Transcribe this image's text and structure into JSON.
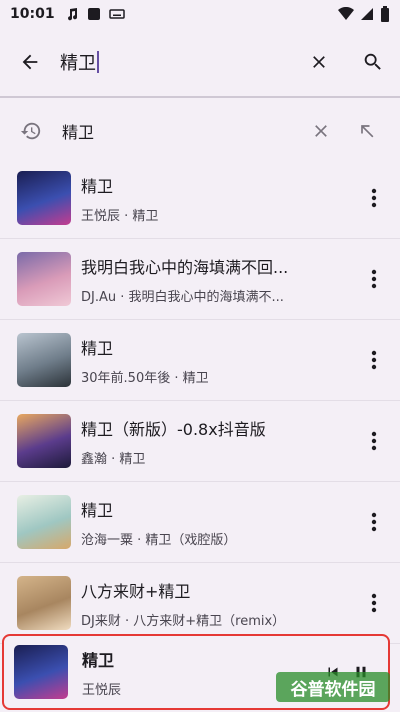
{
  "status_bar": {
    "time": "10:01"
  },
  "search": {
    "query": "精卫"
  },
  "history": {
    "text": "精卫"
  },
  "results": [
    {
      "title": "精卫",
      "subtitle": "王悦辰 · 精卫",
      "art_colors": [
        "#1a1e52",
        "#3b4fb0",
        "#c43c8f"
      ]
    },
    {
      "title": "我明白我心中的海填满不回...",
      "subtitle": "DJ.Au · 我明白我心中的海填满不...",
      "art_colors": [
        "#7a6aa8",
        "#d99bb8",
        "#f0c9d6"
      ]
    },
    {
      "title": "精卫",
      "subtitle": "30年前.50年後 · 精卫",
      "art_colors": [
        "#b9c4cf",
        "#6f7d8a",
        "#2b3238"
      ]
    },
    {
      "title": "精卫（新版）-0.8x抖音版",
      "subtitle": "鑫瀚 · 精卫",
      "art_colors": [
        "#e8a860",
        "#5b3c8c",
        "#1d1a3a"
      ]
    },
    {
      "title": "精卫",
      "subtitle": "沧海一粟 · 精卫（戏腔版）",
      "art_colors": [
        "#e8efe4",
        "#9fc7c2",
        "#d7a86a"
      ]
    },
    {
      "title": "八方来财+精卫",
      "subtitle": "DJ来财 · 八方来财+精卫（remix）",
      "art_colors": [
        "#d4b48a",
        "#a88660",
        "#f0dcc0"
      ]
    }
  ],
  "now_playing": {
    "title": "精卫",
    "subtitle": "王悦辰",
    "art_colors": [
      "#1a1e52",
      "#3b4fb0",
      "#c43c8f"
    ]
  },
  "watermark": {
    "text": "谷普软件园"
  },
  "icons": {
    "back": "arrow-left-icon",
    "clear": "close-icon",
    "search": "search-icon",
    "history": "history-icon",
    "remove": "close-icon",
    "fill": "arrow-up-left-icon",
    "more": "more-vert-icon",
    "prev": "skip-previous-icon",
    "play": "pause-icon"
  }
}
